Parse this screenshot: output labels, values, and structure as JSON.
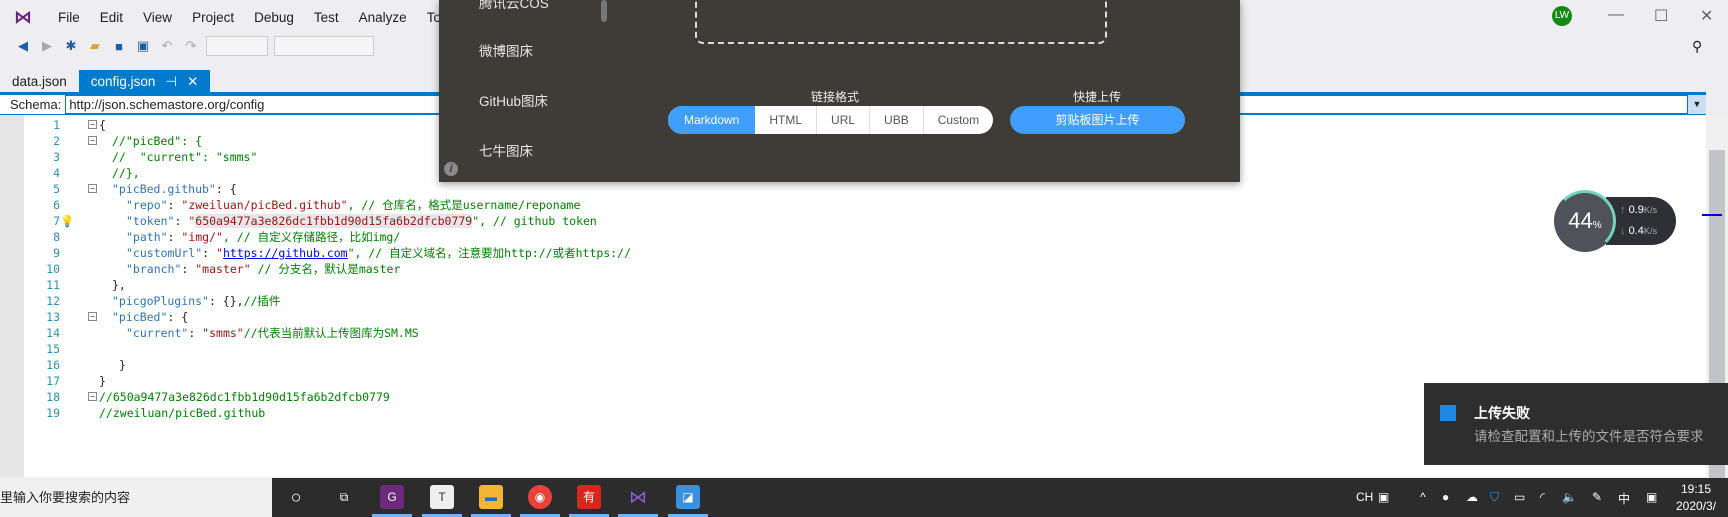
{
  "menu": [
    "File",
    "Edit",
    "View",
    "Project",
    "Debug",
    "Test",
    "Analyze",
    "Tools"
  ],
  "tabs": {
    "inactive": "data.json",
    "active": "config.json",
    "pin": "⊣",
    "close": "✕"
  },
  "schema": {
    "label": "Schema:",
    "value": "http://json.schemastore.org/config"
  },
  "code": {
    "line_numbers": [
      "1",
      "2",
      "3",
      "4",
      "5",
      "6",
      "7",
      "8",
      "9",
      "10",
      "11",
      "12",
      "13",
      "14",
      "15",
      "16",
      "17",
      "18",
      "19"
    ],
    "l1": "{",
    "l2": "//\"picBed\": {",
    "l3": "//  \"current\": \"smms\"",
    "l4": "//},",
    "l5k": "\"picBed.github\"",
    "l5": ": {",
    "l6k": "\"repo\"",
    "l6s": "\"zweiluan/picBed.github\"",
    "l6c": ", // 仓库名，格式是username/reponame",
    "l7k": "\"token\"",
    "l7q": "\"",
    "l7s": "650a9477a3e826dc1fbb1d90d15fa6b2dfcb0779",
    "l7c": "\", // github token",
    "l8k": "\"path\"",
    "l8s": "\"img/\"",
    "l8c": ", // 自定义存储路径，比如img/",
    "l9k": "\"customUrl\"",
    "l9q": "\"",
    "l9u": "https://github.com",
    "l9c": "\", // 自定义域名，注意要加http://或者https://",
    "l10k": "\"branch\"",
    "l10s": "\"master\"",
    "l10c": " // 分支名，默认是master",
    "l11": "},",
    "l12k": "\"picgoPlugins\"",
    "l12": ": {},",
    "l12c": "//插件",
    "l13k": "\"picBed\"",
    "l13": ": {",
    "l14k": "\"current\"",
    "l14s": "\"smms\"",
    "l14c": "//代表当前默认上传图库为SM.MS",
    "l16": "}",
    "l17": "}",
    "l18": "//650a9477a3e826dc1fbb1d90d15fa6b2dfcb0779",
    "l19": "//zweiluan/picBed.github"
  },
  "picgo": {
    "sidebar": [
      "腾讯云COS",
      "微博图床",
      "GitHub图床",
      "七牛图床"
    ],
    "link_format_label": "链接格式",
    "formats": [
      "Markdown",
      "HTML",
      "URL",
      "UBB",
      "Custom"
    ],
    "quick_upload_label": "快捷上传",
    "clipboard_button": "剪贴板图片上传"
  },
  "user_initials": "LW",
  "net_monitor": {
    "percent": "44",
    "pct_sign": "%",
    "up": "0.9",
    "down": "0.4",
    "unit": "K/s"
  },
  "notification": {
    "title": "上传失败",
    "message": "请检查配置和上传的文件是否符合要求"
  },
  "taskbar": {
    "search_placeholder": "里输入你要搜索的内容",
    "ime": "CH",
    "ime_mode": "中",
    "time": "19:15",
    "date": "2020/3/"
  },
  "colors": {
    "accent": "#007acc",
    "picgo_bg": "#3f3c37",
    "picgo_blue": "#409eff"
  }
}
